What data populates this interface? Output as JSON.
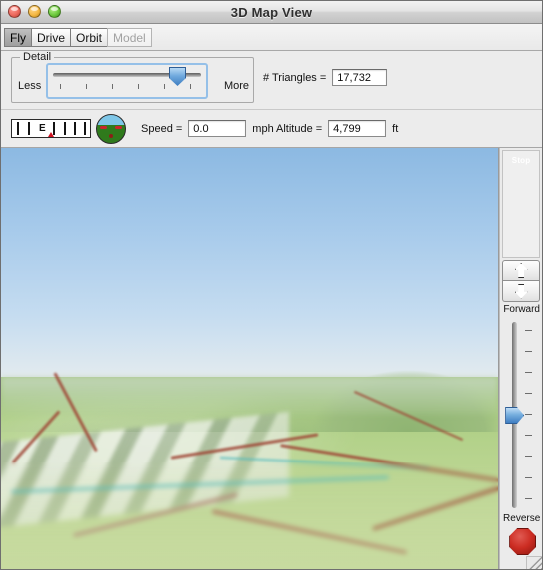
{
  "window": {
    "title": "3D Map View",
    "controls": [
      {
        "name": "close",
        "label": "Close"
      },
      {
        "name": "minimize",
        "label": "Minimize"
      },
      {
        "name": "zoom",
        "label": "Zoom"
      }
    ]
  },
  "modebar": {
    "tabs": [
      {
        "label": "Fly",
        "state": "selected"
      },
      {
        "label": "Drive",
        "state": "normal"
      },
      {
        "label": "Orbit",
        "state": "normal"
      },
      {
        "label": "Model",
        "state": "disabled"
      }
    ]
  },
  "detail": {
    "legend": "Detail",
    "less_label": "Less",
    "more_label": "More",
    "slider_value_percent": 82,
    "tick_count": 6,
    "triangles_label": "# Triangles =",
    "triangles_value": "17,732"
  },
  "instruments": {
    "compass_heading_label": "E",
    "horizon_name": "attitude-indicator",
    "speed_label": "Speed =",
    "speed_value": "0.0",
    "speed_units": "mph",
    "altitude_label": "Altitude =",
    "altitude_value": "4,799",
    "altitude_units": "ft"
  },
  "controls": {
    "up_arrow": "pitch-up",
    "down_arrow": "pitch-down",
    "forward_label": "Forward",
    "reverse_label": "Reverse",
    "throttle_percent": 50,
    "throttle_tick_count": 9,
    "stop_label": "Stop"
  },
  "viewport": {
    "name": "3d-terrain-view",
    "sky_color": "#a8cbeb",
    "ground_color": "#b8d48e",
    "road_color": "#9e4434",
    "water_color": "#4fb9bd",
    "urban_color": "#e9ebea"
  }
}
